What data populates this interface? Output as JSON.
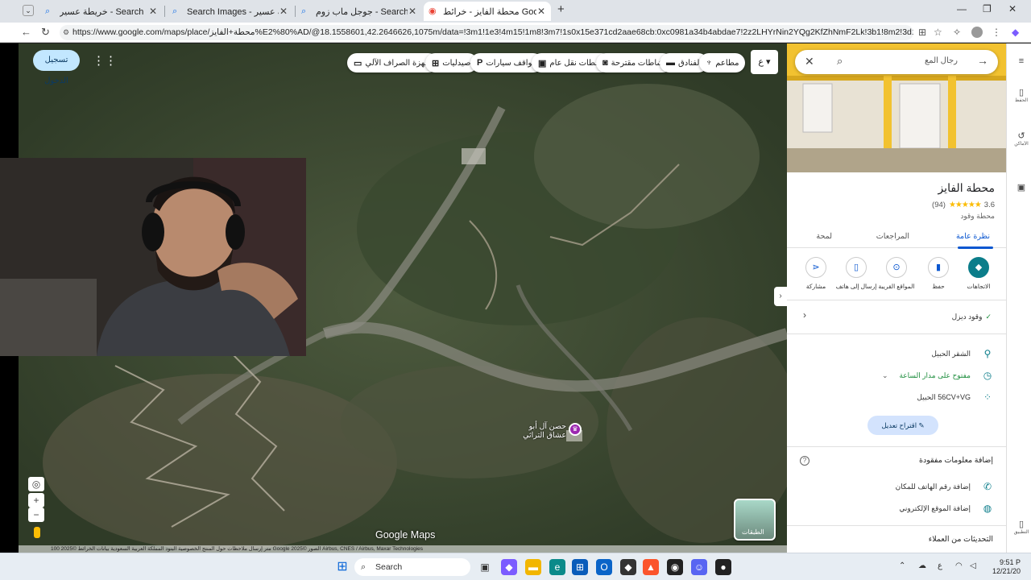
{
  "browser": {
    "tabs": [
      {
        "title": "خريطة عسير - Search",
        "icon": "search-icon",
        "active": false
      },
      {
        "title": "Search Images - خريطة عسير",
        "icon": "search-icon",
        "active": false
      },
      {
        "title": "جوجل ماب زوم - Search",
        "icon": "search-icon",
        "active": false
      },
      {
        "title": "محطة الفايز - خرائط Google",
        "icon": "maps-icon",
        "active": true
      }
    ],
    "new_tab": "+",
    "url": "https://www.google.com/maps/place/محطة+الفايز%E2%80%AD/@18.1558601,42.2646626,1075m/data=!3m1!1e3!4m15!1m8!3m7!1s0x15e371cd2aae68cb:0xc0981a34b4abdae7!2z2LHYrNin2YQg2KfZhNmF2Lk!3b1!8m2!3d18.1521824!4d42.1572702!16s..."
  },
  "map": {
    "signin_label": "تسجيل الدخول",
    "category_chips": [
      {
        "label": "مطاعم",
        "icon": "restaurant-icon"
      },
      {
        "label": "الفنادق",
        "icon": "hotel-icon"
      },
      {
        "label": "نشاطات مقترحة",
        "icon": "camera-icon"
      },
      {
        "label": "محطات نقل عام",
        "icon": "transit-icon"
      },
      {
        "label": "مواقف سيارات",
        "icon": "parking-icon"
      },
      {
        "label": "صيدليات",
        "icon": "pharmacy-icon"
      },
      {
        "label": "أجهزة الصراف الآلي",
        "icon": "atm-icon"
      }
    ],
    "top_letter": "ع",
    "poi_label": "حصن آل أبو عشاق التراثي",
    "logo": "Google Maps",
    "layers_label": "الطبقات",
    "footer": "100 متر    إرسال ملاحظات حول المنتج    الخصوصية    البنود    المملكة العربية السعودية    بيانات الخرائط ©2025 Google    الصور ©2025 Airbus, CNES / Airbus, Maxar Technologies"
  },
  "panel": {
    "search_query": "رجال المع",
    "place_name": "محطة الفايز",
    "rating": "3.6",
    "stars": "★★★★★",
    "review_count": "(94)",
    "category": "محطة وقود",
    "tabs": [
      "نظرة عامة",
      "المراجعات",
      "لمحة"
    ],
    "actions": [
      {
        "label": "الاتجاهات",
        "icon": "directions-icon"
      },
      {
        "label": "حفظ",
        "icon": "bookmark-icon"
      },
      {
        "label": "المواقع القريبة",
        "icon": "nearby-icon"
      },
      {
        "label": "إرسال إلى هاتف",
        "icon": "phone-send-icon"
      },
      {
        "label": "مشاركة",
        "icon": "share-icon"
      }
    ],
    "fuel": "وقود ديزل",
    "address": "الشقر الحبيل",
    "hours": "مفتوح على مدار الساعة",
    "plus_code": "56CV+VG الحبيل",
    "suggest_edit": "اقتراح تعديل",
    "missing_title": "إضافة معلومات مفقودة",
    "add_phone": "إضافة رقم الهاتف للمكان",
    "add_website": "إضافة الموقع الإلكتروني",
    "updates": "التحديثات من العملاء"
  },
  "sidebar": {
    "items": [
      {
        "label": "الحفظ",
        "icon": "bookmark-icon"
      },
      {
        "label": "الأماكن",
        "icon": "history-icon"
      },
      {
        "label": "التطبيق",
        "icon": "phone-icon"
      }
    ]
  },
  "taskbar": {
    "search_label": "Search",
    "time": "9:51 P",
    "date": "12/21/20"
  }
}
